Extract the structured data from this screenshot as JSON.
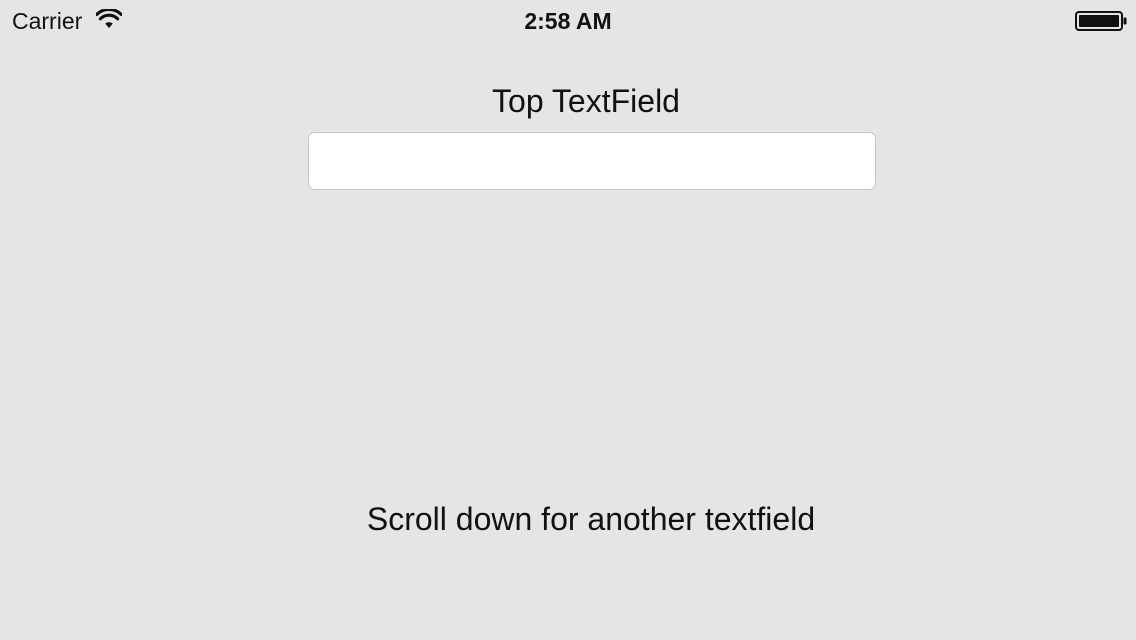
{
  "status_bar": {
    "carrier": "Carrier",
    "time": "2:58 AM"
  },
  "form": {
    "top_label": "Top TextField",
    "top_field_value": "",
    "hint": "Scroll down for another textfield"
  },
  "icons": {
    "wifi": "wifi-icon",
    "battery": "battery-icon"
  }
}
